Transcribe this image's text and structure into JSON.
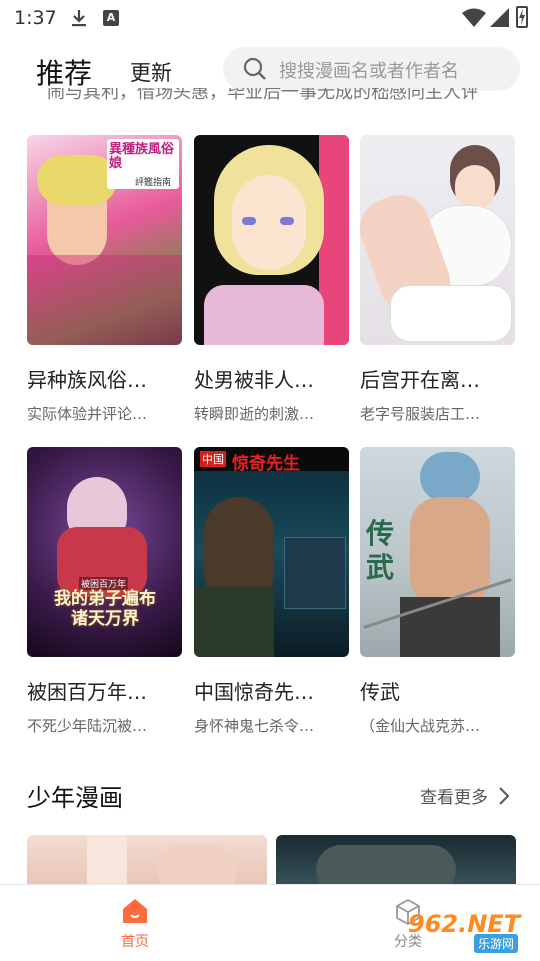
{
  "status": {
    "time": "1:37",
    "a_icon": "A"
  },
  "header": {
    "tabs": [
      "推荐",
      "更新"
    ],
    "search_placeholder": "搜搜漫画名或者作者名"
  },
  "clipped_line": "闹与其利，借场头惠，毕业后一事无成的嵇感同主人评感。",
  "comics": [
    {
      "title": "异种族风俗…",
      "subtitle": "实际体验并评论…",
      "cover_text": "異種族風俗娘",
      "cover_sub": "評鑑指南"
    },
    {
      "title": "处男被非人…",
      "subtitle": "转瞬即逝的刺激…",
      "cover_text": "",
      "cover_sub": ""
    },
    {
      "title": "后宫开在离…",
      "subtitle": "老字号服装店工…",
      "cover_text": "",
      "cover_sub": ""
    },
    {
      "title": "被困百万年…",
      "subtitle": "不死少年陆沉被…",
      "cover_text": "我的弟子遍布诸天万界",
      "cover_sub": "被困百万年"
    },
    {
      "title": "中国惊奇先…",
      "subtitle": "身怀神鬼七杀令…",
      "cover_text": "惊奇先生",
      "cover_sub": "中国"
    },
    {
      "title": "传武",
      "subtitle": "（金仙大战克苏…",
      "cover_text": "传武",
      "cover_sub": ""
    }
  ],
  "section": {
    "title": "少年漫画",
    "more": "查看更多"
  },
  "tabbar": {
    "home": "首页",
    "classify": "分类"
  },
  "watermark": {
    "main": "962.NET",
    "sub": "乐游网"
  },
  "colors": {
    "accent": "#ff6a3d"
  }
}
